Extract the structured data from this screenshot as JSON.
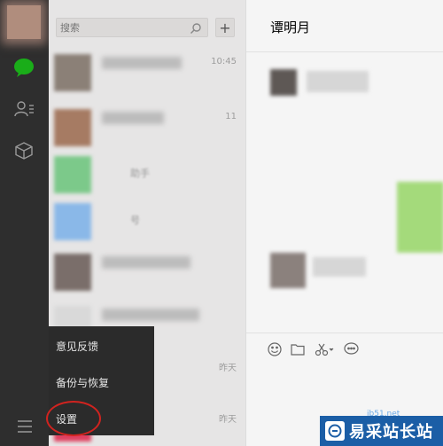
{
  "search": {
    "placeholder": "搜索"
  },
  "add_button": {
    "label": "+"
  },
  "chat_list": [
    {
      "time": "10:45",
      "snippet": ""
    },
    {
      "time": "11",
      "snippet": ""
    },
    {
      "time": "",
      "snippet": "助手"
    },
    {
      "time": "",
      "snippet": "号"
    },
    {
      "time": "",
      "snippet": ""
    },
    {
      "time": "",
      "snippet": ""
    },
    {
      "time": "昨天",
      "snippet": ""
    },
    {
      "time": "昨天",
      "snippet": ""
    }
  ],
  "conversation": {
    "title": "谭明月"
  },
  "popup_menu": {
    "items": [
      "意见反馈",
      "备份与恢复",
      "设置"
    ]
  },
  "watermark": {
    "brand": "易采站长站",
    "url": "jb51.net"
  },
  "colors": {
    "sidebar": "#2e2e2e",
    "chat_active": "#1aad19",
    "highlight": "#d1231f"
  }
}
